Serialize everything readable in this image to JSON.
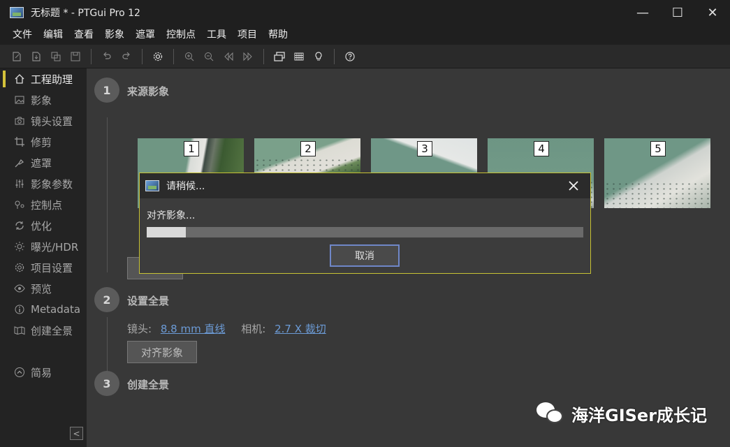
{
  "window": {
    "title": "无标题 * - PTGui Pro 12",
    "controls": {
      "minimize": "—",
      "maximize": "☐",
      "close": "✕"
    }
  },
  "menubar": {
    "items": [
      "文件",
      "编辑",
      "查看",
      "影象",
      "遮罩",
      "控制点",
      "工具",
      "项目",
      "帮助"
    ]
  },
  "toolbar": {
    "icons": [
      "new-project-icon",
      "open-project-icon",
      "copy-icon",
      "save-icon",
      "undo-icon",
      "redo-icon",
      "settings-icon",
      "zoom-in-icon",
      "zoom-out-icon",
      "rewind-icon",
      "forward-icon",
      "panorama-editor-icon",
      "grid-icon",
      "lightbulb-icon",
      "help-icon"
    ]
  },
  "sidebar": {
    "items": [
      {
        "label": "工程助理",
        "icon": "home-icon",
        "active": true
      },
      {
        "label": "影象",
        "icon": "image-icon"
      },
      {
        "label": "镜头设置",
        "icon": "camera-icon"
      },
      {
        "label": "修剪",
        "icon": "crop-icon"
      },
      {
        "label": "遮罩",
        "icon": "mask-icon"
      },
      {
        "label": "影象参数",
        "icon": "sliders-icon"
      },
      {
        "label": "控制点",
        "icon": "control-points-icon"
      },
      {
        "label": "优化",
        "icon": "optimize-icon"
      },
      {
        "label": "曝光/HDR",
        "icon": "sun-icon"
      },
      {
        "label": "项目设置",
        "icon": "gear-icon"
      },
      {
        "label": "预览",
        "icon": "eye-icon"
      },
      {
        "label": "Metadata",
        "icon": "info-icon"
      },
      {
        "label": "创建全景",
        "icon": "map-icon"
      }
    ],
    "simple_label": "简易",
    "collapse_label": "<"
  },
  "steps": [
    {
      "num": "1",
      "title": "来源影象"
    },
    {
      "num": "2",
      "title": "设置全景"
    },
    {
      "num": "3",
      "title": "创建全景"
    }
  ],
  "thumbnails": [
    "1",
    "2",
    "3",
    "4",
    "5"
  ],
  "settings": {
    "lens_label": "镜头:",
    "lens_value": "8.8 mm 直线",
    "camera_label": "相机:",
    "camera_value": "2.7 X 裁切",
    "align_button": "对齐影象"
  },
  "dialog": {
    "title": "请稍候...",
    "message": "对齐影象...",
    "progress": 0.09,
    "cancel_label": "取消"
  },
  "watermark": {
    "text": "海洋GISer成长记"
  },
  "colors": {
    "accent": "#d4c23a",
    "link": "#6c9bd6",
    "dialog_border": "#c7c234"
  }
}
